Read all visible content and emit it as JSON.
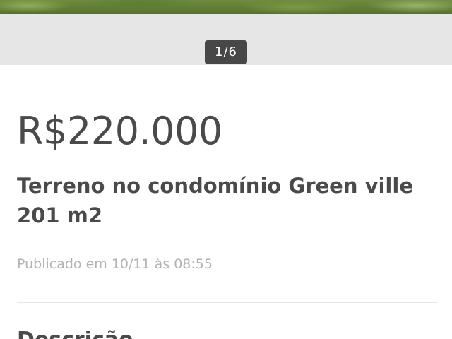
{
  "gallery": {
    "photo_watermark": "",
    "counter": "1/6"
  },
  "listing": {
    "price": "R$220.000",
    "title": "Terreno no condomínio Green ville 201 m2",
    "published": "Publicado em 10/11 às 08:55"
  },
  "description": {
    "heading": "Descrição"
  },
  "colors": {
    "counter_background": "#474747",
    "gallery_background": "#e6e6e6",
    "text_primary": "#4a4a4a",
    "text_muted": "#b3b3b3"
  }
}
